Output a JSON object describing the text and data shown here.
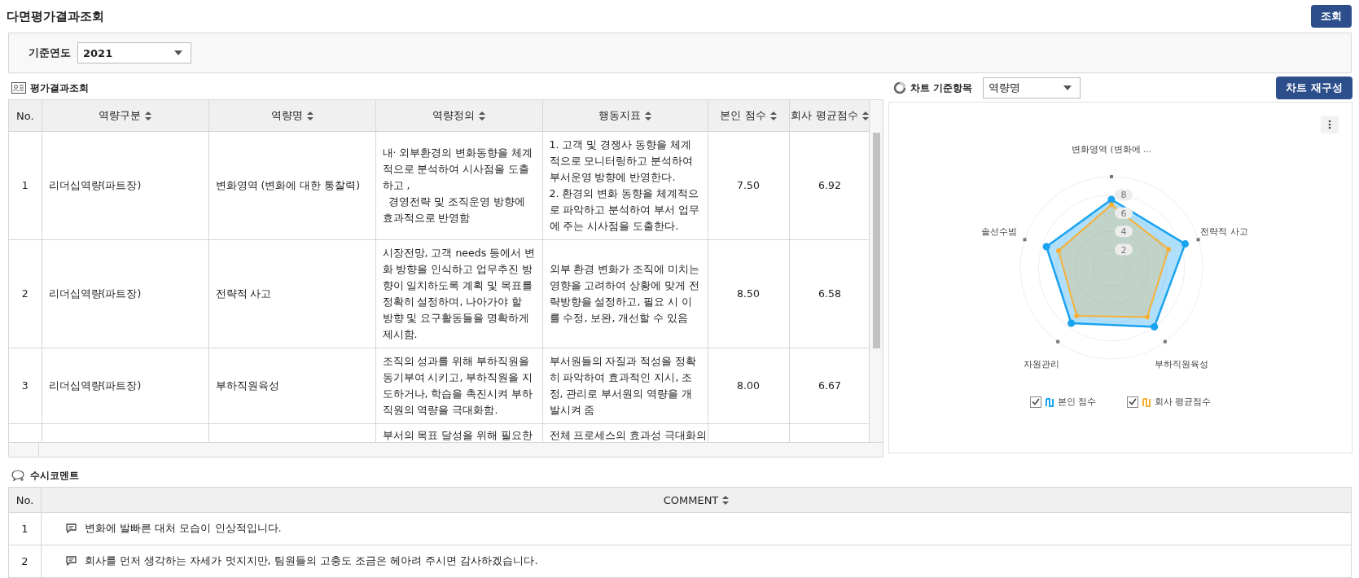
{
  "page": {
    "title": "다면평가결과조회",
    "search_button": "조회"
  },
  "filter": {
    "label": "기준연도",
    "year": {
      "value": "2021"
    }
  },
  "results": {
    "title": "평가결과조회",
    "columns": [
      {
        "label": "No.",
        "sortable": false
      },
      {
        "label": "역량구분",
        "sortable": true
      },
      {
        "label": "역량명",
        "sortable": true
      },
      {
        "label": "역량정의",
        "sortable": true
      },
      {
        "label": "행동지표",
        "sortable": true
      },
      {
        "label": "본인 점수",
        "sortable": true
      },
      {
        "label": "회사 평균점수",
        "sortable": true
      }
    ],
    "rows": [
      {
        "cells": [
          "1",
          "리더십역량(파트장)",
          "변화영역 (변화에 대한 통찰력)",
          "내· 외부환경의 변화동향을 체계적으로 분석하여 시사점을 도출하고 ,\n  경영전략 및 조직운영 방향에 효과적으로 반영함",
          "1. 고객 및 경쟁사 동향을 체계적으로 모니터링하고 분석하여 부서운영 방향에 반영한다.\n2. 환경의 변화 동향을 체계적으로 파악하고 분석하여 부서 업무에 주는 시사점을 도출한다.",
          "7.50",
          "6.92"
        ]
      },
      {
        "cells": [
          "2",
          "리더십역량(파트장)",
          "전략적 사고",
          "시장전망, 고객 needs 등에서 변화 방향을 인식하고 업무추진 방향이 일치하도록 계획 및 목표를 정확히 설정하며, 나아가야 할 방향 및 요구활동들을 명확하게 제시함.",
          "외부 환경 변화가 조직에 미치는 영향을 고려하여 상황에 맞게 전략방향을 설정하고, 필요 시 이를 수정, 보완, 개선할 수 있음",
          "8.50",
          "6.58"
        ]
      },
      {
        "cells": [
          "3",
          "리더십역량(파트장)",
          "부하직원육성",
          "조직의 성과를 위해 부하직원을 동기부여 시키고, 부하직원을 지도하거나, 학습을 촉진시켜 부하직원의 역량을 극대화함.",
          "부서원들의 자질과 적성을 정확히 파악하여 효과적인 지시, 조정, 관리로 부서원의 역량을 개발시켜 줌",
          "8.00",
          "6.67"
        ]
      },
      {
        "cells": [
          null,
          null,
          null,
          "부서의 목표 달성을 위해 필요한",
          "전체 프로세스의 효과성 극대화의",
          null,
          null
        ]
      }
    ]
  },
  "chart_panel": {
    "label": "차트 기준항목",
    "basis": {
      "value": "역량명"
    },
    "rebuild_button": "차트 재구성",
    "chart_data": {
      "type": "radar",
      "categories": [
        "변화영역 (변화에 ...",
        "전략적 사고",
        "부하직원육성",
        "자원관리",
        "솔선수범"
      ],
      "series": [
        {
          "name": "본인 점수",
          "color": "#1aa3f0",
          "values": [
            7.5,
            8.5,
            8.0,
            7.5,
            7.5
          ]
        },
        {
          "name": "회사 평균점수",
          "color": "#f7b035",
          "values": [
            6.92,
            6.58,
            6.67,
            6.5,
            6.1
          ]
        }
      ],
      "ylim": [
        0,
        10
      ],
      "yticks": [
        2,
        4,
        6,
        8
      ]
    },
    "legend": [
      {
        "checked": true
      },
      {
        "checked": true
      }
    ]
  },
  "comments": {
    "title": "수시코멘트",
    "columns": [
      {
        "label": "No.",
        "sortable": false
      },
      {
        "label": "COMMENT",
        "sortable": true
      }
    ],
    "rows": [
      {
        "no": "1",
        "text": "변화에 발빠른 대처 모습이 인상적입니다."
      },
      {
        "no": "2",
        "text": "회사를 먼저 생각하는 자세가 멋지지만, 팀원들의 고충도 조금은 헤아려 주시면 감사하겠습니다."
      }
    ]
  }
}
